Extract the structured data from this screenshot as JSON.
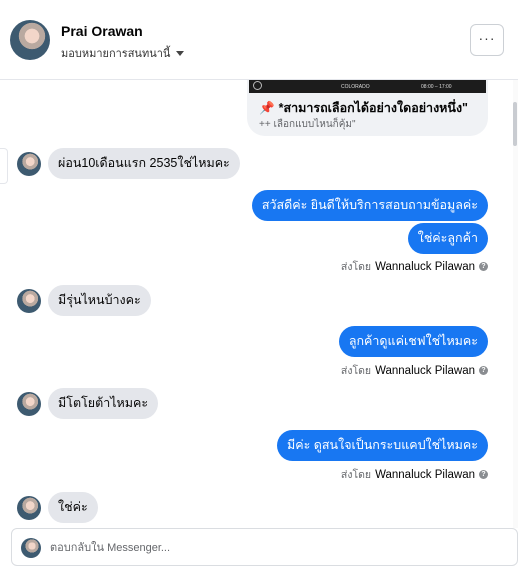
{
  "header": {
    "name": "Prai Orawan",
    "assign_label": "มอบหมายการสนทนานี้",
    "more_label": "···"
  },
  "card": {
    "strip_text_1": "COLORADO",
    "strip_text_2": "08:00 – 17:00",
    "title": "*สามารถเลือกได้อย่างใดอย่างหนึ่ง\"",
    "subtitle": "++ เลือกแบบไหนก็คุ้ม\""
  },
  "messages": [
    {
      "text": "ผ่อน10เดือนแรก 2535ใช่ไหมคะ"
    },
    {
      "text": "สวัสดีค่ะ  ยินดีให้บริการสอบถามข้อมูลค่ะ"
    },
    {
      "text": "ใช่ค่ะลูกค้า"
    },
    {
      "text": "มีรุ่นไหนบ้างคะ"
    },
    {
      "text": "ลูกค้าดูแค่เชฟใช่ไหมคะ"
    },
    {
      "text": "มีโตโยต้าไหมคะ"
    },
    {
      "text": "มีค่ะ  ดูสนใจเป็นกระบแคปใช่ไหมคะ"
    },
    {
      "text": "ใช่ค่ะ"
    }
  ],
  "sent_by": {
    "prefix": "ส่งโดย",
    "agent": "Wannaluck Pilawan",
    "info": "?"
  },
  "reply": {
    "placeholder": "ตอบกลับใน Messenger..."
  },
  "colors": {
    "outgoing": "#1877f2",
    "incoming": "#e4e6eb"
  }
}
